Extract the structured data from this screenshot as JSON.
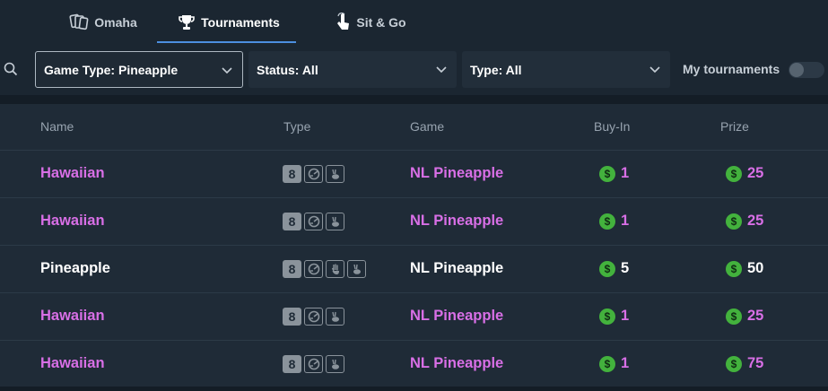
{
  "tabs": [
    {
      "label": "Omaha",
      "icon": "cards-icon",
      "active": false
    },
    {
      "label": "Tournaments",
      "icon": "trophy-icon",
      "active": true
    },
    {
      "label": "Sit & Go",
      "icon": "hand-pointer-icon",
      "active": false
    }
  ],
  "filters": {
    "game_type": "Game Type: Pineapple",
    "status": "Status: All",
    "type": "Type: All",
    "my_tournaments_label": "My tournaments",
    "my_tournaments_on": false
  },
  "table": {
    "headers": {
      "name": "Name",
      "type": "Type",
      "game": "Game",
      "buyin": "Buy-In",
      "prize": "Prize"
    },
    "rows": [
      {
        "name": "Hawaiian",
        "game": "NL Pineapple",
        "buyin": "1",
        "prize": "25",
        "highlight": true,
        "type_badges": [
          "8",
          "turbo-icon",
          "rabbit-icon"
        ]
      },
      {
        "name": "Hawaiian",
        "game": "NL Pineapple",
        "buyin": "1",
        "prize": "25",
        "highlight": true,
        "type_badges": [
          "8",
          "turbo-icon",
          "rabbit-icon"
        ]
      },
      {
        "name": "Pineapple",
        "game": "NL Pineapple",
        "buyin": "5",
        "prize": "50",
        "highlight": false,
        "type_badges": [
          "8",
          "turbo-icon",
          "hand-icon",
          "rabbit-icon"
        ]
      },
      {
        "name": "Hawaiian",
        "game": "NL Pineapple",
        "buyin": "1",
        "prize": "25",
        "highlight": true,
        "type_badges": [
          "8",
          "turbo-icon",
          "rabbit-icon"
        ]
      },
      {
        "name": "Hawaiian",
        "game": "NL Pineapple",
        "buyin": "1",
        "prize": "75",
        "highlight": true,
        "type_badges": [
          "8",
          "turbo-icon",
          "rabbit-icon"
        ]
      }
    ]
  },
  "colors": {
    "accent_purple": "#d86fe6",
    "coin_green": "#43b23d",
    "tab_underline": "#4c8fe0"
  }
}
